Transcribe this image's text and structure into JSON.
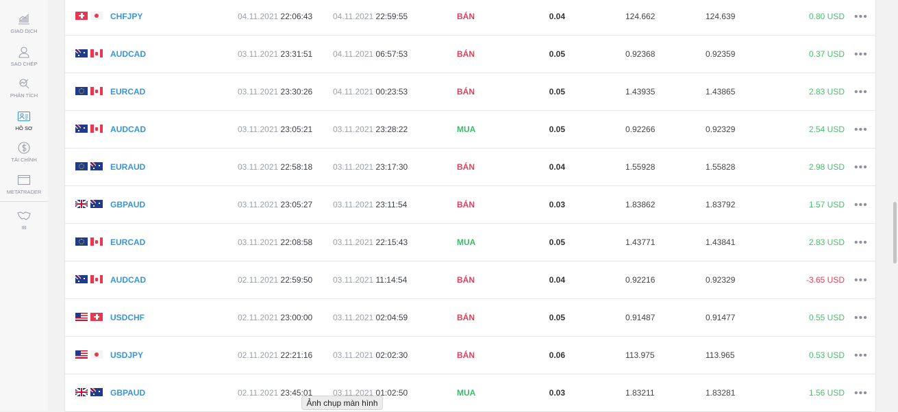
{
  "sidebar": {
    "items": [
      {
        "label": "GIAO DỊCH",
        "icon": "chart-growth-icon"
      },
      {
        "label": "SAO CHÉP",
        "icon": "user-icon"
      },
      {
        "label": "PHÂN TÍCH",
        "icon": "analysis-icon"
      },
      {
        "label": "HỒ SƠ",
        "icon": "profile-card-icon",
        "active": true
      },
      {
        "label": "TÀI CHÍNH",
        "icon": "dollar-icon"
      },
      {
        "label": "METATRADER",
        "icon": "window-icon"
      },
      {
        "label": "IB",
        "icon": "handshake-icon"
      }
    ]
  },
  "colors": {
    "sell": "#e0405a",
    "buy": "#3cb86a",
    "symbol": "#3a95d3"
  },
  "rows": [
    {
      "flags": [
        "CH",
        "JP"
      ],
      "symbol": "CHFJPY",
      "open_date": "04.11.2021",
      "open_time": "22:06:43",
      "close_date": "04.11.2021",
      "close_time": "22:59:55",
      "type": "BÁN",
      "volume": "0.04",
      "open_price": "124.662",
      "close_price": "124.639",
      "profit": "0.80 USD"
    },
    {
      "flags": [
        "AU",
        "CA"
      ],
      "symbol": "AUDCAD",
      "open_date": "03.11.2021",
      "open_time": "23:31:51",
      "close_date": "04.11.2021",
      "close_time": "06:57:53",
      "type": "BÁN",
      "volume": "0.05",
      "open_price": "0.92368",
      "close_price": "0.92359",
      "profit": "0.37 USD"
    },
    {
      "flags": [
        "EU",
        "CA"
      ],
      "symbol": "EURCAD",
      "open_date": "03.11.2021",
      "open_time": "23:30:26",
      "close_date": "04.11.2021",
      "close_time": "00:23:53",
      "type": "BÁN",
      "volume": "0.05",
      "open_price": "1.43935",
      "close_price": "1.43865",
      "profit": "2.83 USD"
    },
    {
      "flags": [
        "AU",
        "CA"
      ],
      "symbol": "AUDCAD",
      "open_date": "03.11.2021",
      "open_time": "23:05:21",
      "close_date": "03.11.2021",
      "close_time": "23:28:22",
      "type": "MUA",
      "volume": "0.05",
      "open_price": "0.92266",
      "close_price": "0.92329",
      "profit": "2.54 USD"
    },
    {
      "flags": [
        "EU",
        "AU"
      ],
      "symbol": "EURAUD",
      "open_date": "03.11.2021",
      "open_time": "22:58:18",
      "close_date": "03.11.2021",
      "close_time": "23:17:30",
      "type": "BÁN",
      "volume": "0.04",
      "open_price": "1.55928",
      "close_price": "1.55828",
      "profit": "2.98 USD"
    },
    {
      "flags": [
        "GB",
        "AU"
      ],
      "symbol": "GBPAUD",
      "open_date": "03.11.2021",
      "open_time": "23:05:27",
      "close_date": "03.11.2021",
      "close_time": "23:11:54",
      "type": "BÁN",
      "volume": "0.03",
      "open_price": "1.83862",
      "close_price": "1.83792",
      "profit": "1.57 USD"
    },
    {
      "flags": [
        "EU",
        "CA"
      ],
      "symbol": "EURCAD",
      "open_date": "03.11.2021",
      "open_time": "22:08:58",
      "close_date": "03.11.2021",
      "close_time": "22:15:43",
      "type": "MUA",
      "volume": "0.05",
      "open_price": "1.43771",
      "close_price": "1.43841",
      "profit": "2.83 USD"
    },
    {
      "flags": [
        "AU",
        "CA"
      ],
      "symbol": "AUDCAD",
      "open_date": "02.11.2021",
      "open_time": "22:59:50",
      "close_date": "03.11.2021",
      "close_time": "11:14:54",
      "type": "BÁN",
      "volume": "0.04",
      "open_price": "0.92216",
      "close_price": "0.92329",
      "profit": "-3.65 USD"
    },
    {
      "flags": [
        "US",
        "CH"
      ],
      "symbol": "USDCHF",
      "open_date": "02.11.2021",
      "open_time": "23:00:00",
      "close_date": "03.11.2021",
      "close_time": "02:04:59",
      "type": "BÁN",
      "volume": "0.05",
      "open_price": "0.91487",
      "close_price": "0.91477",
      "profit": "0.55 USD"
    },
    {
      "flags": [
        "US",
        "JP"
      ],
      "symbol": "USDJPY",
      "open_date": "02.11.2021",
      "open_time": "22:21:16",
      "close_date": "03.11.2021",
      "close_time": "02:02:30",
      "type": "BÁN",
      "volume": "0.06",
      "open_price": "113.975",
      "close_price": "113.965",
      "profit": "0.53 USD"
    },
    {
      "flags": [
        "GB",
        "AU"
      ],
      "symbol": "GBPAUD",
      "open_date": "02.11.2021",
      "open_time": "23:45:01",
      "close_date": "03.11.2021",
      "close_time": "01:02:50",
      "type": "MUA",
      "volume": "0.03",
      "open_price": "1.83211",
      "close_price": "1.83281",
      "profit": "1.56 USD"
    }
  ],
  "more_label": "•••",
  "tooltip": "Ảnh chụp màn hình"
}
